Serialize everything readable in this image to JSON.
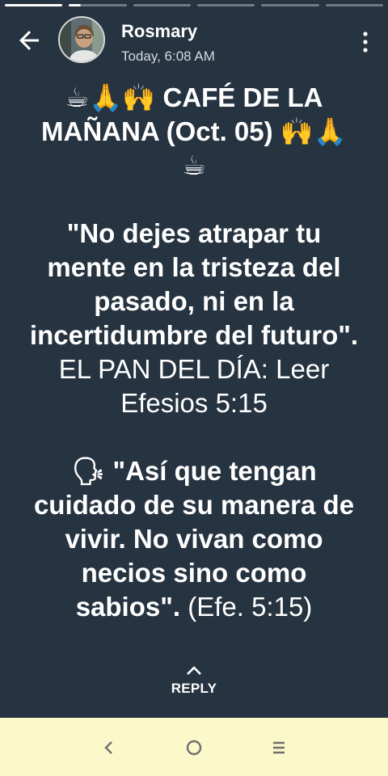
{
  "story": {
    "segments_total": 6,
    "current_segment": 2,
    "current_progress": 0.2
  },
  "header": {
    "name": "Rosmary",
    "time": "Today, 6:08 AM"
  },
  "content": {
    "title_line1": "☕🙏🙌 CAFÉ DE LA",
    "title_line2": "MAÑANA (Oct. 05) 🙌🙏",
    "title_line3": "☕",
    "quote_line1": "\"No dejes atrapar tu",
    "quote_line2": "mente en la tristeza del",
    "quote_line3": "pasado, ni en la",
    "quote_line4": "incertidumbre del futuro\".",
    "pan_line1": "EL PAN DEL DÍA: Leer",
    "pan_line2": "Efesios 5:15",
    "verse_line1": "🗣 \"Así que tengan",
    "verse_line2": "cuidado de su manera de",
    "verse_line3": "vivir. No vivan como",
    "verse_line4": "necios sino como",
    "verse_line5_bold": "sabios\".",
    "verse_line5_ref": " (Efe. 5:15)"
  },
  "reply": {
    "label": "REPLY"
  },
  "colors": {
    "background": "#263340",
    "navbar": "#fbf8ca",
    "text": "#ffffff"
  },
  "icons": {
    "back": "arrow-back-icon",
    "more": "more-vert-icon",
    "reply": "chevron-up-icon",
    "nav_back": "nav-back-icon",
    "nav_home": "nav-home-icon",
    "nav_recents": "nav-recents-icon"
  }
}
